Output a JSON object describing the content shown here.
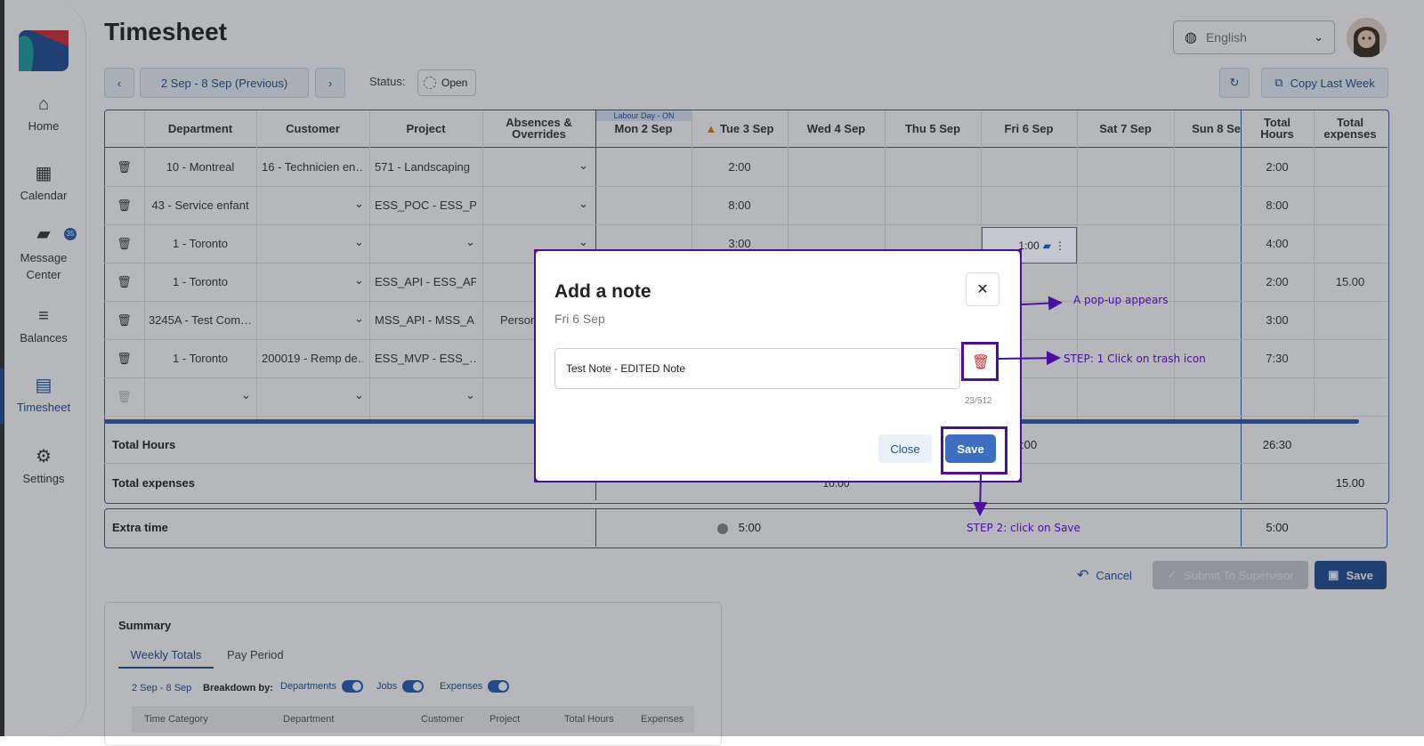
{
  "page": {
    "title": "Timesheet"
  },
  "sidebar": {
    "items": [
      {
        "label": "Home",
        "icon": "home-icon"
      },
      {
        "label": "Calendar",
        "icon": "calendar-icon"
      },
      {
        "label": "Message Center",
        "icon": "chat-icon",
        "badge": "35"
      },
      {
        "label": "Balances",
        "icon": "balances-icon"
      },
      {
        "label": "Timesheet",
        "icon": "document-icon",
        "active": true
      },
      {
        "label": "Settings",
        "icon": "gear-icon"
      }
    ]
  },
  "header": {
    "language": "English"
  },
  "toolbar": {
    "period_label": "2 Sep - 8 Sep (Previous)",
    "status_label": "Status:",
    "status_value": "Open",
    "copy_last_week": "Copy Last Week"
  },
  "table": {
    "headers": {
      "department": "Department",
      "customer": "Customer",
      "project": "Project",
      "absences_1": "Absences &",
      "absences_2": "Overrides",
      "holiday": "Labour Day - ON",
      "mon": "Mon 2 Sep",
      "tue": "Tue 3 Sep",
      "wed": "Wed 4 Sep",
      "thu": "Thu 5 Sep",
      "fri": "Fri 6 Sep",
      "sat": "Sat 7 Sep",
      "sun": "Sun 8 Se",
      "total_hours_1": "Total",
      "total_hours_2": "Hours",
      "total_exp_1": "Total",
      "total_exp_2": "expenses"
    },
    "rows": [
      {
        "department": "10 - Montreal",
        "customer": "16 - Technicien en…",
        "project": "571 - Landscaping",
        "absence": "",
        "tue": "2:00",
        "fri": "",
        "total_hours": "2:00",
        "total_exp": ""
      },
      {
        "department": "43 - Service enfant",
        "customer": "",
        "project": "ESS_POC - ESS_P…",
        "absence": "",
        "tue": "8:00",
        "fri": "",
        "total_hours": "8:00",
        "total_exp": ""
      },
      {
        "department": "1 - Toronto",
        "customer": "",
        "project": "",
        "absence": "",
        "tue": "3:00",
        "fri": "1:00",
        "total_hours": "4:00",
        "total_exp": ""
      },
      {
        "department": "1 - Toronto",
        "customer": "",
        "project": "ESS_API - ESS_AP…",
        "absence": "",
        "tue": "",
        "fri": "",
        "total_hours": "2:00",
        "total_exp": "15.00"
      },
      {
        "department": "3245A - Test Com…",
        "customer": "",
        "project": "MSS_API - MSS_A…",
        "absence": "Person",
        "tue": "",
        "fri": "",
        "total_hours": "3:00",
        "total_exp": ""
      },
      {
        "department": "1 - Toronto",
        "customer": "200019 - Remp de…",
        "project": "ESS_MVP - ESS_…",
        "absence": "",
        "tue": "",
        "fri": "",
        "total_hours": "7:30",
        "total_exp": ""
      }
    ],
    "totals": {
      "hours_label": "Total Hours",
      "hours_fri_partial": ":00",
      "hours_total": "26:30",
      "expenses_label": "Total expenses",
      "expenses_wed_partial": "10.00",
      "expenses_total": "15.00"
    },
    "extra": {
      "label": "Extra time",
      "tue": "5:00",
      "total": "5:00"
    }
  },
  "actions": {
    "cancel": "Cancel",
    "submit": "Submit To Supervisor",
    "save": "Save"
  },
  "summary": {
    "title": "Summary",
    "tabs": [
      "Weekly Totals",
      "Pay Period"
    ],
    "range": "2 Sep - 8 Sep",
    "breakdown_label": "Breakdown by:",
    "toggles": [
      "Departments",
      "Jobs",
      "Expenses"
    ],
    "columns": [
      "Time Category",
      "Department",
      "Customer",
      "Project",
      "Total Hours",
      "Expenses"
    ]
  },
  "modal": {
    "title": "Add a note",
    "subtitle": "Fri 6 Sep",
    "note_value": "Test Note - EDITED Note",
    "counter": "23/512",
    "close": "Close",
    "save": "Save"
  },
  "annotations": {
    "popup": "A pop-up appears",
    "step1": "STEP: 1 Click on trash icon",
    "step2": "STEP 2: click on Save"
  },
  "colors": {
    "accent": "#1f4e96",
    "annotation": "#4b0fa0",
    "delete": "#d32f2f"
  }
}
